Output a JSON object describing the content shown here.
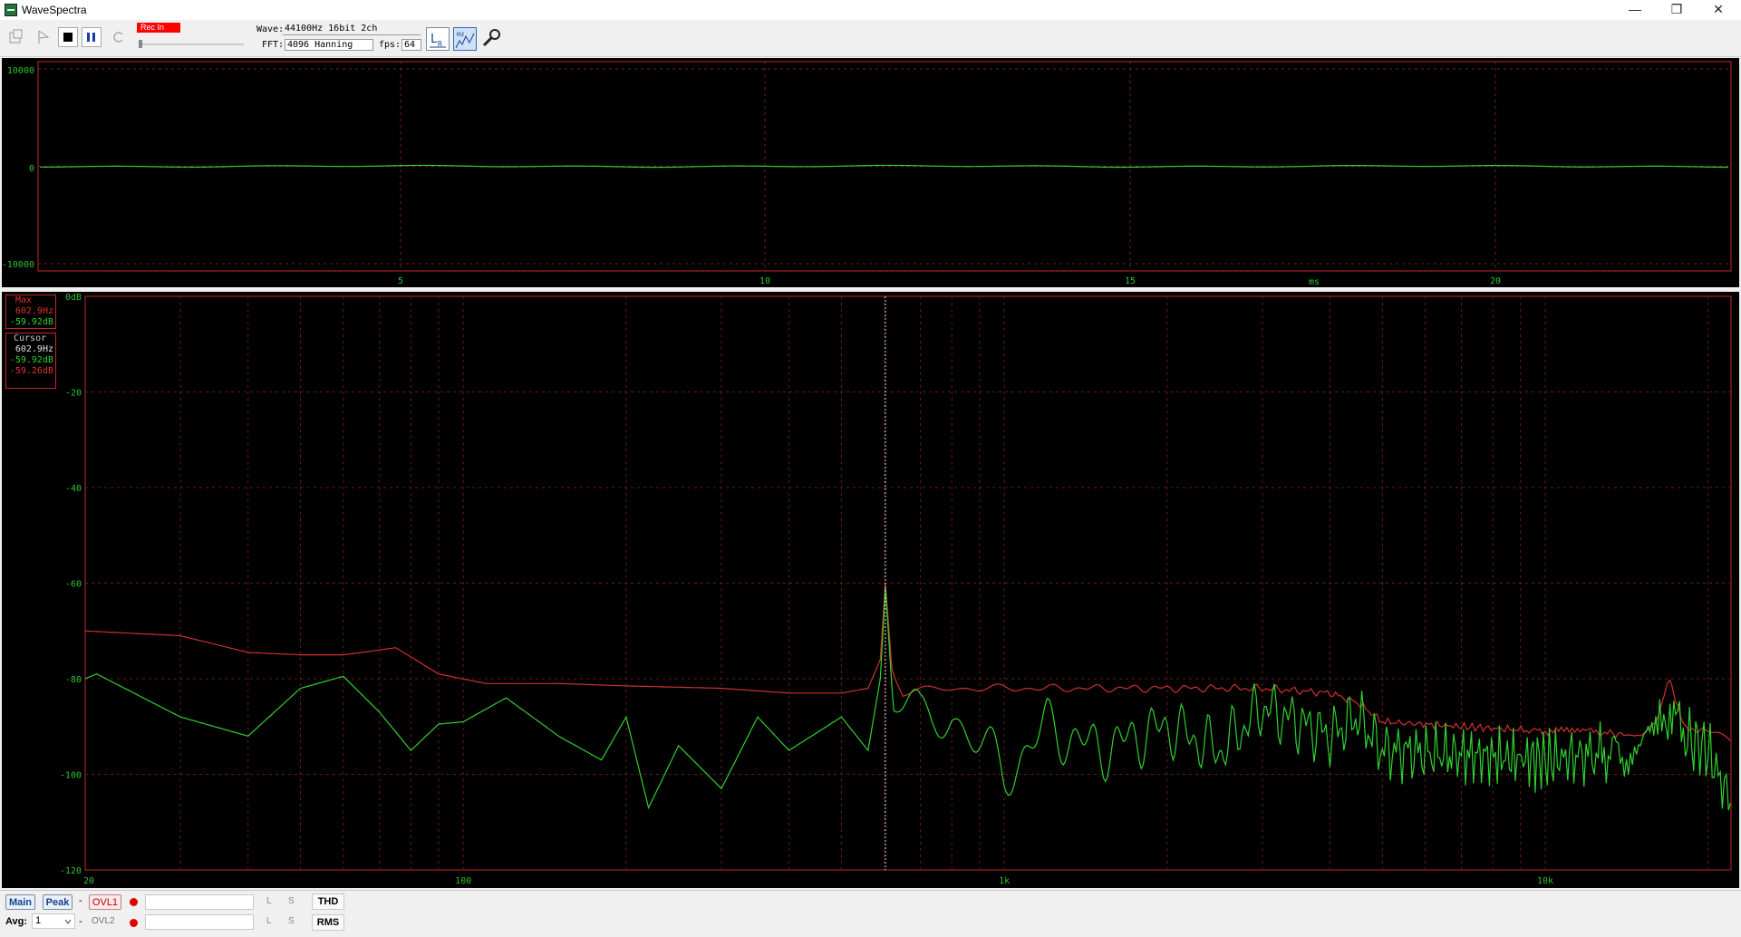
{
  "window": {
    "title": "WaveSpectra",
    "controls": [
      "—",
      "❐",
      "✕"
    ]
  },
  "toolbar": {
    "rec_label": "Rec In",
    "wave_label": "Wave:",
    "wave_value": "44100Hz 16bit 2ch",
    "fft_label": "FFT:",
    "fft_value": "4096 Hanning",
    "fps_label": "fps:",
    "fps_value": "64"
  },
  "waveform": {
    "y_ticks": [
      "10000",
      "0",
      "-10000"
    ],
    "x_ticks": [
      "5",
      "10",
      "15",
      "20"
    ],
    "x_unit": "ms"
  },
  "spectrum": {
    "y_ticks": [
      "0dB",
      "-20",
      "-40",
      "-60",
      "-80",
      "-100",
      "-120"
    ],
    "x_ticks": [
      "20",
      "100",
      "1k",
      "10k"
    ],
    "max_box": {
      "title": "Max",
      "freq": "602.9Hz",
      "db": "-59.92dB"
    },
    "cursor_box": {
      "title": "Cursor",
      "freq": "602.9Hz",
      "db_l": "-59.92dB",
      "db_r": "-59.26dB"
    },
    "cursor_freq_hz": 602.9
  },
  "chart_data": {
    "type": "line",
    "xlabel": "",
    "ylabel": "",
    "xscale": "log",
    "xlim": [
      20,
      22050
    ],
    "ylim": [
      -120,
      0
    ],
    "series": [
      {
        "color": "#d03030",
        "x": [
          20,
          30,
          40,
          50,
          60,
          65,
          75,
          90,
          110,
          150,
          200,
          300,
          400,
          500,
          560,
          590,
          602.9,
          620,
          650,
          700,
          800,
          1000,
          1500,
          2000,
          3000,
          4000,
          4500,
          5000,
          7000,
          10000,
          12000,
          15000,
          16000,
          17000,
          18000,
          20000,
          22000
        ],
        "y": [
          -70,
          -71,
          -74.5,
          -75,
          -75,
          -74.5,
          -73.5,
          -79,
          -81,
          -81,
          -81.5,
          -82,
          -83,
          -83,
          -82,
          -76,
          -60,
          -78,
          -83,
          -82.5,
          -82,
          -82,
          -82,
          -82,
          -82,
          -83,
          -85,
          -89,
          -90,
          -91,
          -91,
          -92,
          -89,
          -80,
          -90,
          -91,
          -93
        ]
      },
      {
        "color": "#30d030",
        "x": [
          20,
          21,
          30,
          40,
          50,
          60,
          70,
          80,
          90,
          100,
          120,
          150,
          180,
          200,
          220,
          250,
          300,
          350,
          400,
          500,
          560,
          590,
          602.9,
          620,
          650,
          700,
          800,
          1000,
          1200,
          1500,
          2000,
          2500,
          3000,
          4000,
          4500,
          5000,
          7000,
          10000,
          12000,
          15000,
          16000,
          17000,
          18000,
          20000,
          22000
        ],
        "y": [
          -80,
          -79,
          -88,
          -92,
          -82,
          -79.5,
          -87,
          -95,
          -89.5,
          -89,
          -84,
          -92,
          -97,
          -88,
          -107,
          -94,
          -103,
          -88,
          -95,
          -88,
          -95,
          -80,
          -61,
          -82,
          -86,
          -90,
          -87,
          -100,
          -90,
          -95,
          -90,
          -95,
          -86,
          -92,
          -88,
          -95,
          -96,
          -97,
          -96,
          -95,
          -93,
          -86,
          -92,
          -95,
          -106
        ]
      }
    ]
  }
}
